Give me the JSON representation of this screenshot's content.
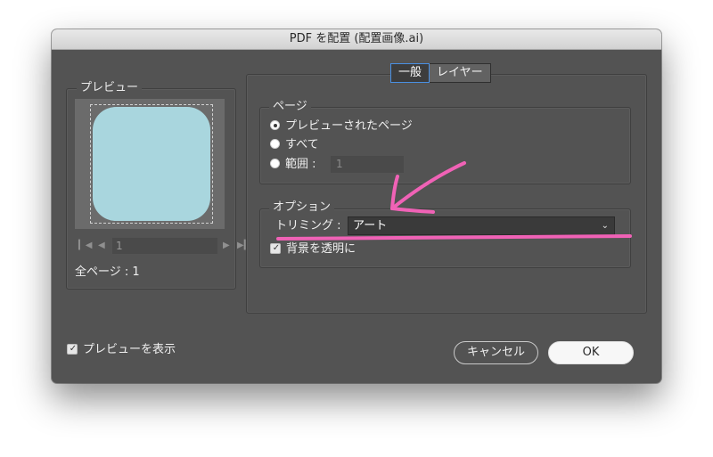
{
  "window": {
    "title": "PDF を配置 (配置画像.ai)"
  },
  "tabs": [
    {
      "label": "一般",
      "active": true
    },
    {
      "label": "レイヤー",
      "active": false
    }
  ],
  "preview_panel": {
    "legend": "プレビュー",
    "art_color": "#a9d6de",
    "pager": {
      "first_icon": "first-page-icon",
      "prev_icon": "prev-page-icon",
      "value": "1",
      "next_icon": "next-page-icon",
      "last_icon": "last-page-icon"
    },
    "all_pages": "全ページ : 1"
  },
  "page_section": {
    "legend": "ページ",
    "options": [
      {
        "label": "プレビューされたページ",
        "checked": true
      },
      {
        "label": "すべて",
        "checked": false
      },
      {
        "label": "範囲 :",
        "checked": false
      }
    ],
    "range_value": "1"
  },
  "option_section": {
    "legend": "オプション",
    "trim_label": "トリミング :",
    "trim_value": "アート",
    "transparent_bg": {
      "label": "背景を透明に",
      "checked": true
    }
  },
  "show_preview": {
    "label": "プレビューを表示",
    "checked": true
  },
  "buttons": {
    "cancel": "キャンセル",
    "ok": "OK"
  },
  "annotation": {
    "color": "#f062b6"
  }
}
